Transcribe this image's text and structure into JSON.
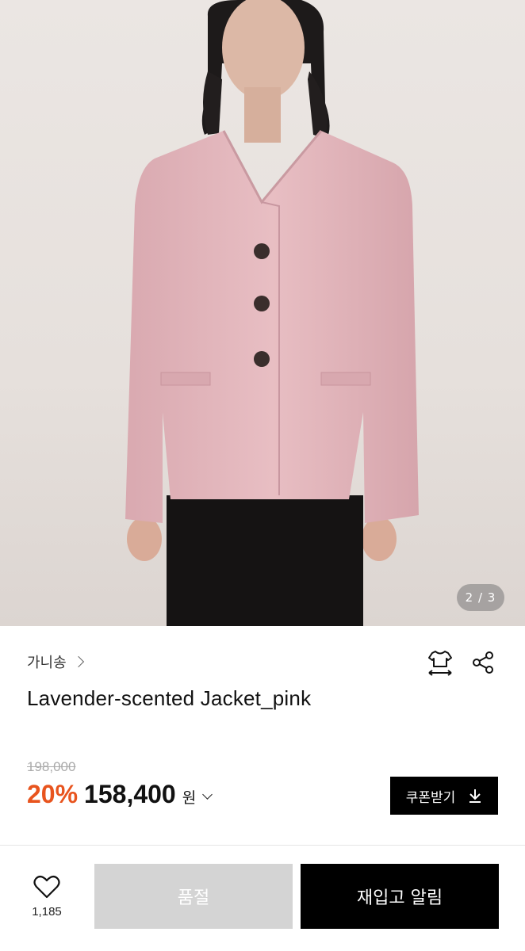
{
  "gallery": {
    "counter": "2 / 3"
  },
  "product": {
    "brand": "가니송",
    "title": "Lavender-scented Jacket_pink",
    "original_price": "198,000",
    "discount": "20%",
    "price": "158,400",
    "currency": "원"
  },
  "actions": {
    "coupon_label": "쿠폰받기",
    "like_count": "1,185",
    "soldout_label": "품절",
    "restock_label": "재입고 알림"
  },
  "colors": {
    "discount": "#e8541e",
    "jacket": "#e3b7bd"
  }
}
